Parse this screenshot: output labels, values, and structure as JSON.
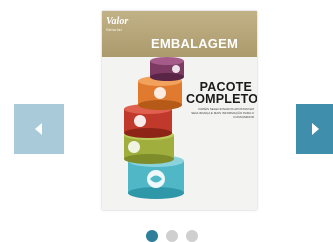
{
  "carousel": {
    "prev_icon": "chevron-left-icon",
    "next_icon": "chevron-right-icon",
    "colors": {
      "prev_button": "#a9cbd9",
      "next_button": "#3f8fac",
      "dot_active": "#2f7f9b",
      "dot_inactive": "#cfcfcf"
    },
    "active_slide": 1,
    "slide_count": 3
  },
  "cover": {
    "brand": "Valor",
    "brand_sub": "Setorial",
    "brand_date": "",
    "section_title": "EMBALAGEM",
    "headline_line1": "PACOTE",
    "headline_line2": "COMPLETO",
    "subhead": "PAPÉIS SELECIONADOS APOSTAM EM SEGURANÇA E MAIS INFORMAÇÃO PARA O CONSUMIDOR",
    "footer_left": "",
    "footer_right": "",
    "colors": {
      "masthead": "#b8a77a"
    }
  }
}
